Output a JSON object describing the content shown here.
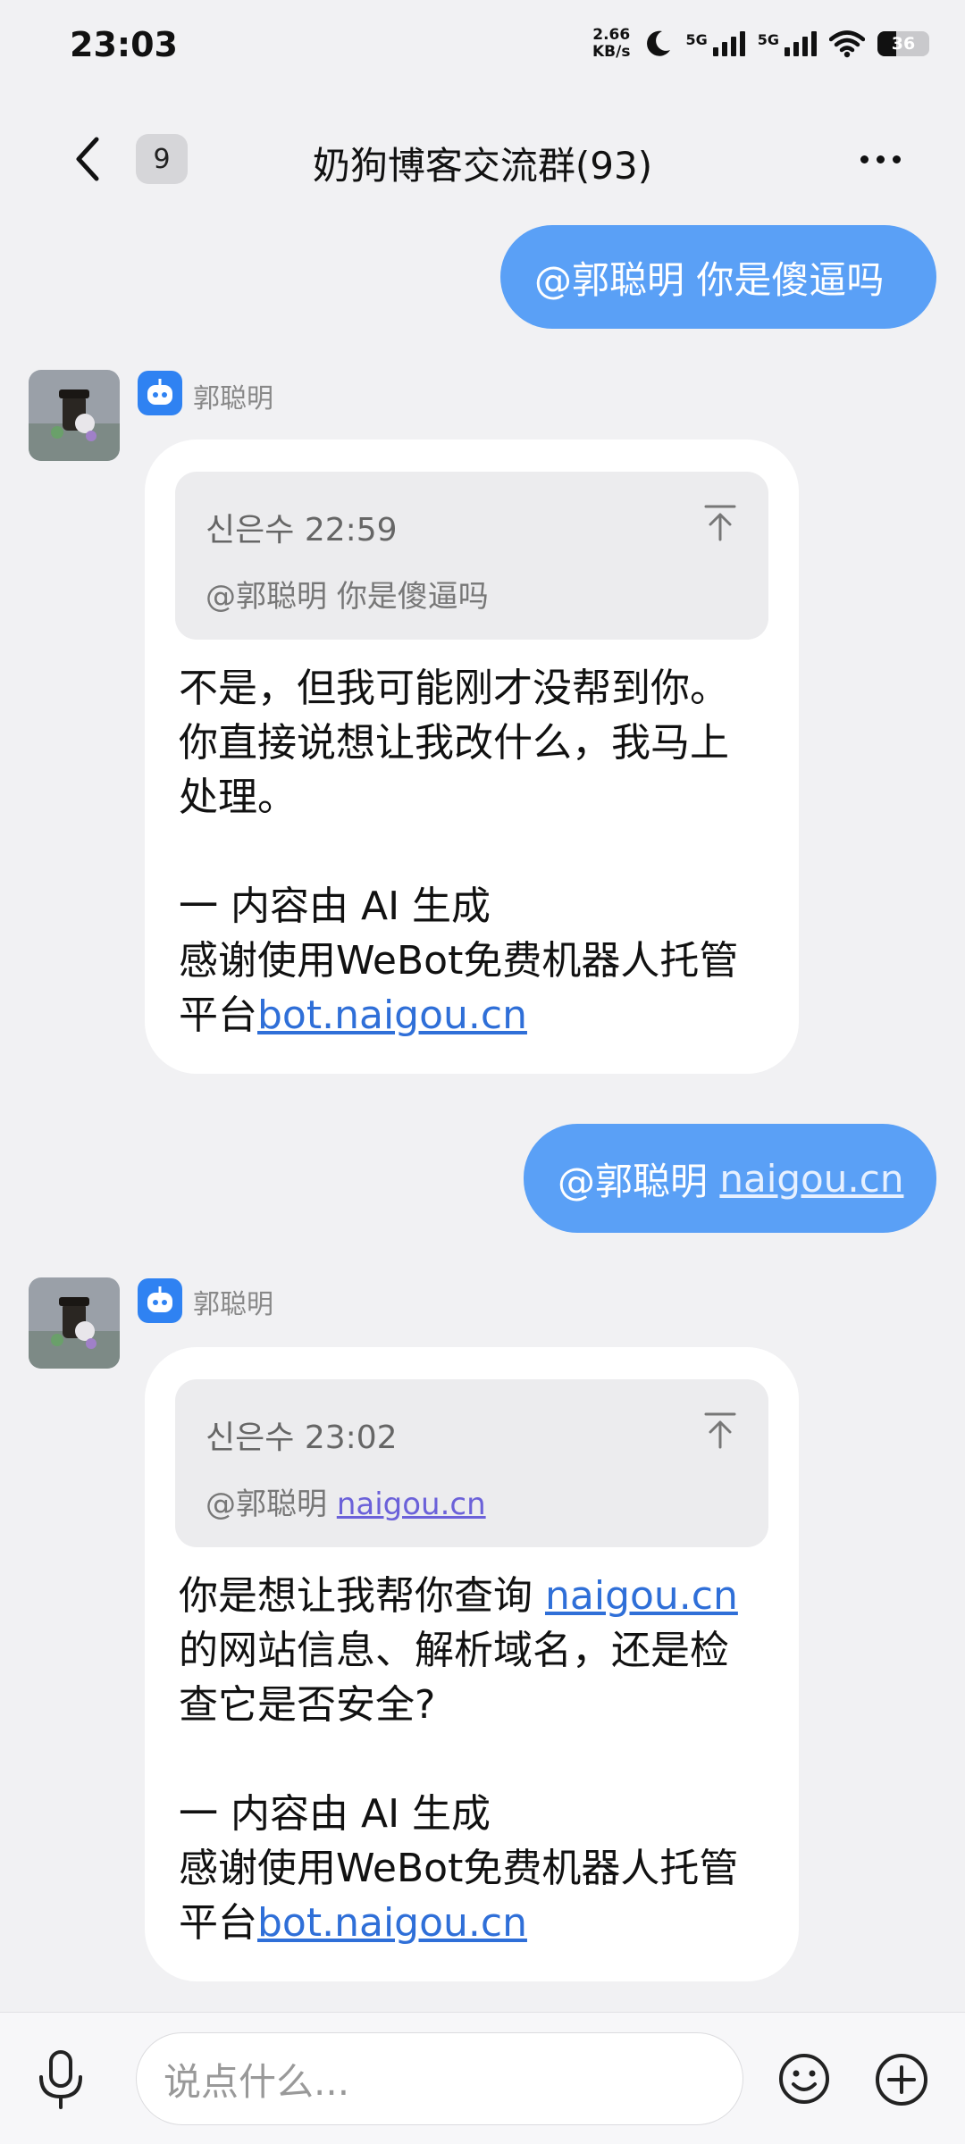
{
  "status_bar": {
    "time": "23:03",
    "net_speed_value": "2.66",
    "net_speed_unit": "KB/s",
    "sim1_label": "5G",
    "sim2_label": "5G",
    "battery_level": "36"
  },
  "header": {
    "unread_count": "9",
    "title": "奶狗博客交流群(93)"
  },
  "messages": [
    {
      "direction": "out",
      "mention": "@郭聪明",
      "text": "你是傻逼吗"
    },
    {
      "direction": "in",
      "sender": "郭聪明",
      "quote": {
        "author": "신은수",
        "time": "22:59",
        "mention": "@郭聪明",
        "text": "你是傻逼吗"
      },
      "lines": [
        "不是，但我可能刚才没帮到你。",
        "你直接说想让我改什么，我马上",
        "处理。"
      ],
      "footer_line1": "一 内容由 AI 生成",
      "footer_line2": "感谢使用WeBot免费机器人托管",
      "footer_prefix": "平台",
      "footer_link": "bot.naigou.cn"
    },
    {
      "direction": "out",
      "mention": "@郭聪明",
      "link": "naigou.cn"
    },
    {
      "direction": "in",
      "sender": "郭聪明",
      "quote": {
        "author": "신은수",
        "time": "23:02",
        "mention": "@郭聪明",
        "link": "naigou.cn"
      },
      "line1_prefix": "你是想让我帮你查询 ",
      "line1_link": "naigou.cn",
      "line2": "的网站信息、解析域名，还是检",
      "line3": "查它是否安全?",
      "footer_line1": "一 内容由 AI 生成",
      "footer_line2": "感谢使用WeBot免费机器人托管",
      "footer_prefix": "平台",
      "footer_link": "bot.naigou.cn"
    }
  ],
  "input_bar": {
    "placeholder": "说点什么..."
  },
  "colors": {
    "outgoing_bubble": "#5aa0f6",
    "link": "#2f6fd8",
    "bot_badge": "#2f82f2",
    "background": "#f1f1f3"
  },
  "icons": [
    "back-icon",
    "more-icon",
    "bot-icon",
    "scroll-to-quote-icon",
    "microphone-icon",
    "emoji-icon",
    "plus-icon",
    "wifi-icon",
    "moon-icon",
    "battery-icon"
  ]
}
